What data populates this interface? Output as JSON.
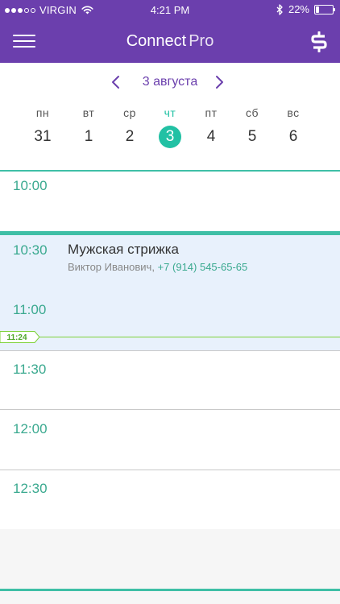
{
  "status_bar": {
    "carrier": "VIRGIN",
    "time": "4:21 PM",
    "battery": "22%",
    "battery_level": 0.22,
    "signal_bars_filled": 3,
    "signal_bars_total": 5
  },
  "header": {
    "title_main": "Connect",
    "title_sub": "Pro"
  },
  "date_nav": {
    "label": "3 августа"
  },
  "week": [
    {
      "name": "пн",
      "num": "31",
      "active": false
    },
    {
      "name": "вт",
      "num": "1",
      "active": false
    },
    {
      "name": "ср",
      "num": "2",
      "active": false
    },
    {
      "name": "чт",
      "num": "3",
      "active": true
    },
    {
      "name": "пт",
      "num": "4",
      "active": false
    },
    {
      "name": "сб",
      "num": "5",
      "active": false
    },
    {
      "name": "вс",
      "num": "6",
      "active": false
    }
  ],
  "schedule": {
    "slots": [
      "10:00",
      "10:30",
      "11:00",
      "11:30",
      "12:00",
      "12:30"
    ],
    "appointment": {
      "title": "Мужская стрижка",
      "client": "Виктор Иванович,",
      "phone": "+7 (914) 545-65-65"
    },
    "now_time": "11:24"
  },
  "colors": {
    "brand": "#6b3fad",
    "accent": "#22c1a4",
    "time_text": "#3aa98f",
    "appointment_bg": "#e8f1fc",
    "now_line": "#7ed23a"
  }
}
